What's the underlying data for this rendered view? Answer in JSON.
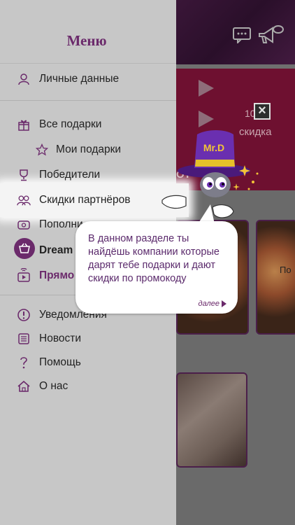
{
  "background": {
    "banner_count": "10",
    "banner_word": "скидка",
    "banner_word2": "ОТ",
    "card_label": "По"
  },
  "drawer": {
    "title": "Меню",
    "items": [
      {
        "label": "Личные данные",
        "icon": "user-icon"
      },
      {
        "label": "Все подарки",
        "icon": "gift-icon"
      },
      {
        "label": "Мои подарки",
        "icon": "star-icon"
      },
      {
        "label": "Победители",
        "icon": "trophy-icon"
      },
      {
        "label": "Скидки партнёров",
        "icon": "partners-icon"
      },
      {
        "label": "Пополни",
        "icon": "wallet-icon"
      },
      {
        "label": "Dream",
        "icon": "basket-icon"
      },
      {
        "label": "Прямо",
        "icon": "tv-icon"
      },
      {
        "label": "Уведомления",
        "icon": "alert-icon"
      },
      {
        "label": "Новости",
        "icon": "news-icon"
      },
      {
        "label": "Помощь",
        "icon": "help-icon"
      },
      {
        "label": "О нас",
        "icon": "home-icon"
      }
    ]
  },
  "tooltip": {
    "text": "В данном разделе ты найдёшь компании которые дарят тебе подарки и дают скидки по промокоду",
    "more": "далее"
  },
  "mascot": {
    "hat_label": "Mr.D"
  },
  "colors": {
    "brand_purple": "#6b2a6b",
    "drawer_bg": "#c7c7c7",
    "banner_red": "#6e1030"
  }
}
